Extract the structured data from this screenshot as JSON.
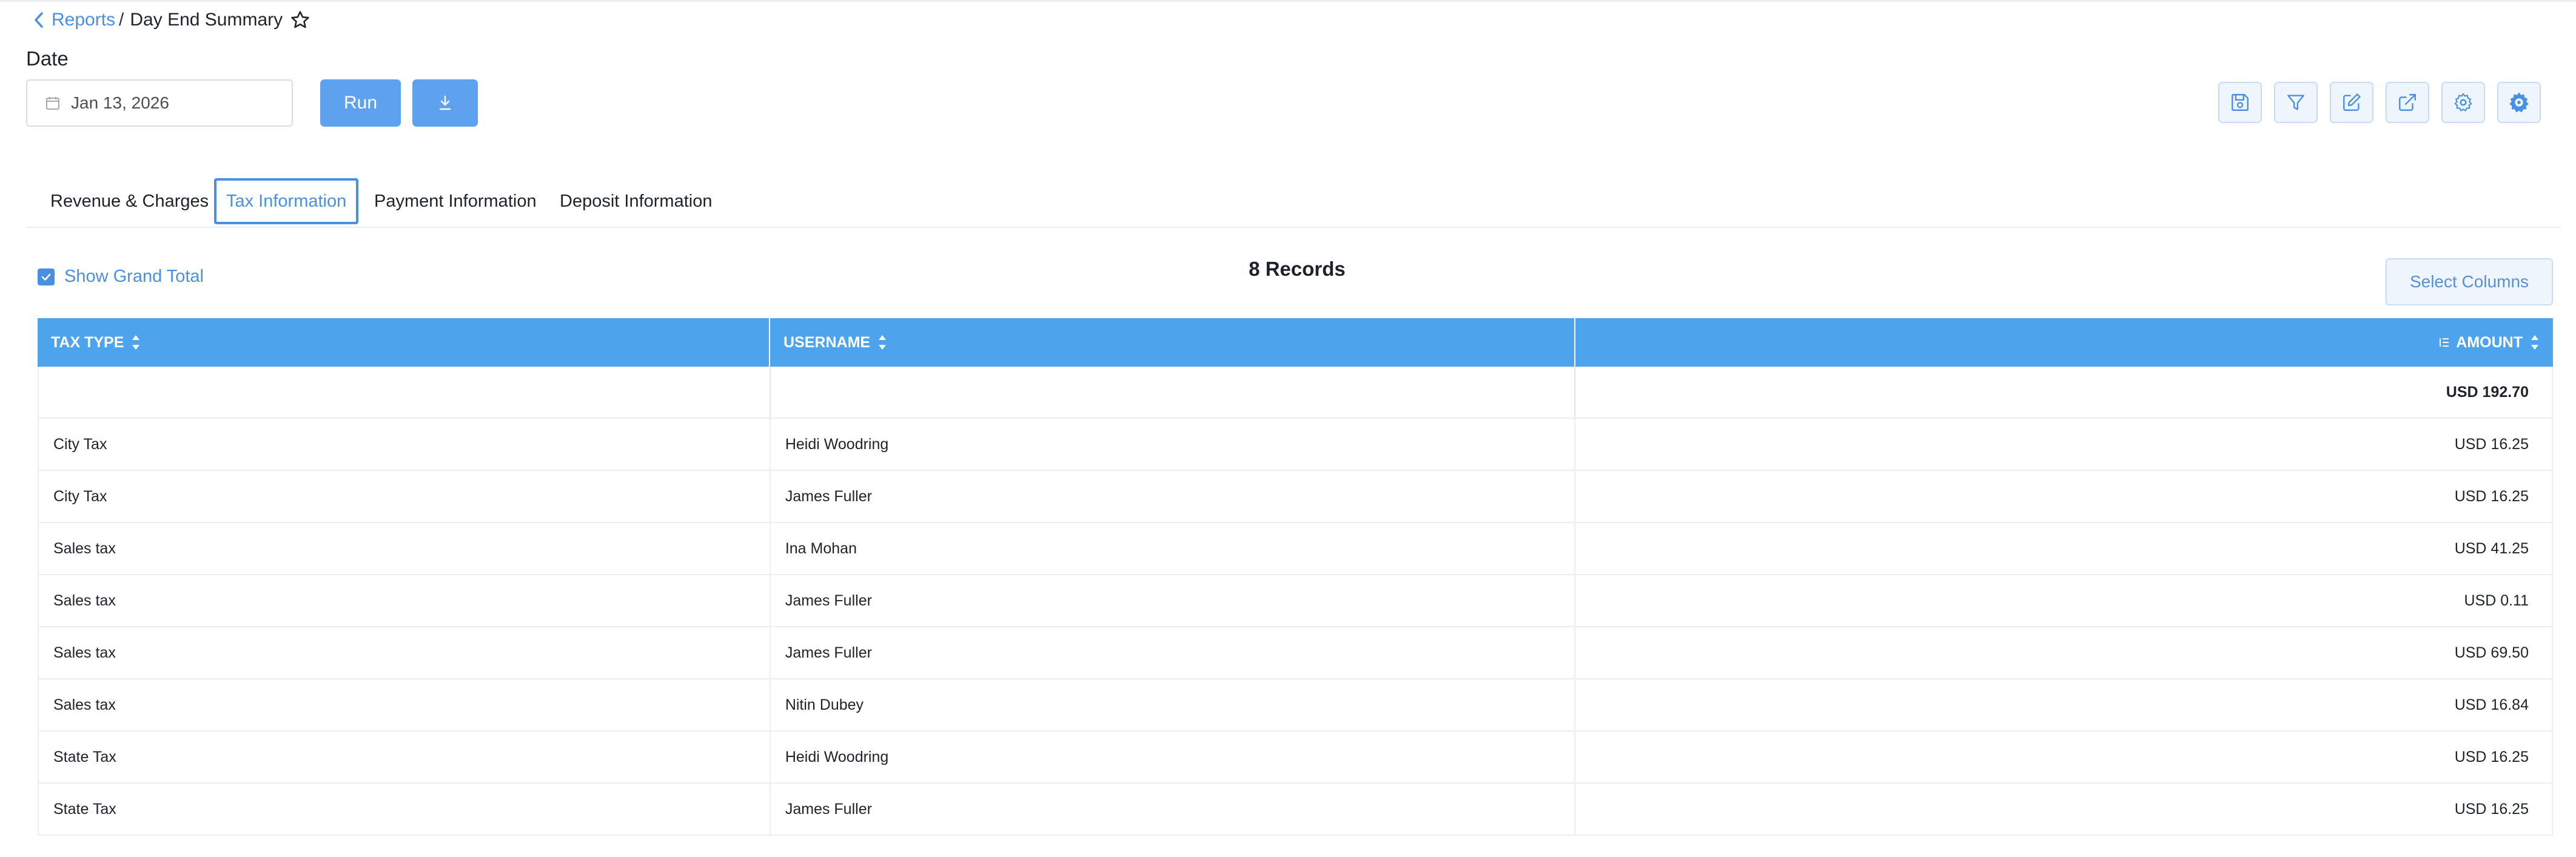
{
  "breadcrumb": {
    "parent": "Reports",
    "separator": "/",
    "current": "Day End Summary"
  },
  "date_filter": {
    "label": "Date",
    "value": "Jan 13, 2026"
  },
  "actions": {
    "run_label": "Run"
  },
  "toolbar": {
    "icons": [
      "save-icon",
      "filter-icon",
      "edit-icon",
      "export-icon",
      "settings-icon",
      "gear-badge-icon"
    ]
  },
  "tabs": [
    {
      "label": "Revenue & Charges",
      "active": false
    },
    {
      "label": "Tax Information",
      "active": true
    },
    {
      "label": "Payment Information",
      "active": false
    },
    {
      "label": "Deposit Information",
      "active": false
    }
  ],
  "options": {
    "show_grand_total_label": "Show Grand Total",
    "show_grand_total_checked": true
  },
  "records_label": "8 Records",
  "select_columns_label": "Select Columns",
  "table": {
    "columns": [
      "TAX TYPE",
      "USERNAME",
      "AMOUNT"
    ],
    "grand_total": {
      "tax_type": "",
      "username": "",
      "amount": "USD 192.70"
    },
    "rows": [
      {
        "tax_type": "City Tax",
        "username": "Heidi Woodring",
        "amount": "USD 16.25"
      },
      {
        "tax_type": "City Tax",
        "username": "James Fuller",
        "amount": "USD 16.25"
      },
      {
        "tax_type": "Sales tax",
        "username": "Ina Mohan",
        "amount": "USD 41.25"
      },
      {
        "tax_type": "Sales tax",
        "username": "James Fuller",
        "amount": "USD 0.11"
      },
      {
        "tax_type": "Sales tax",
        "username": "James Fuller",
        "amount": "USD 69.50"
      },
      {
        "tax_type": "Sales tax",
        "username": "Nitin Dubey",
        "amount": "USD 16.84"
      },
      {
        "tax_type": "State Tax",
        "username": "Heidi Woodring",
        "amount": "USD 16.25"
      },
      {
        "tax_type": "State Tax",
        "username": "James Fuller",
        "amount": "USD 16.25"
      }
    ]
  },
  "colors": {
    "accent": "#4a90e2",
    "header_bg": "#4da3ec",
    "button_bg": "#5ea2ef",
    "tool_bg": "#eef5fd"
  }
}
